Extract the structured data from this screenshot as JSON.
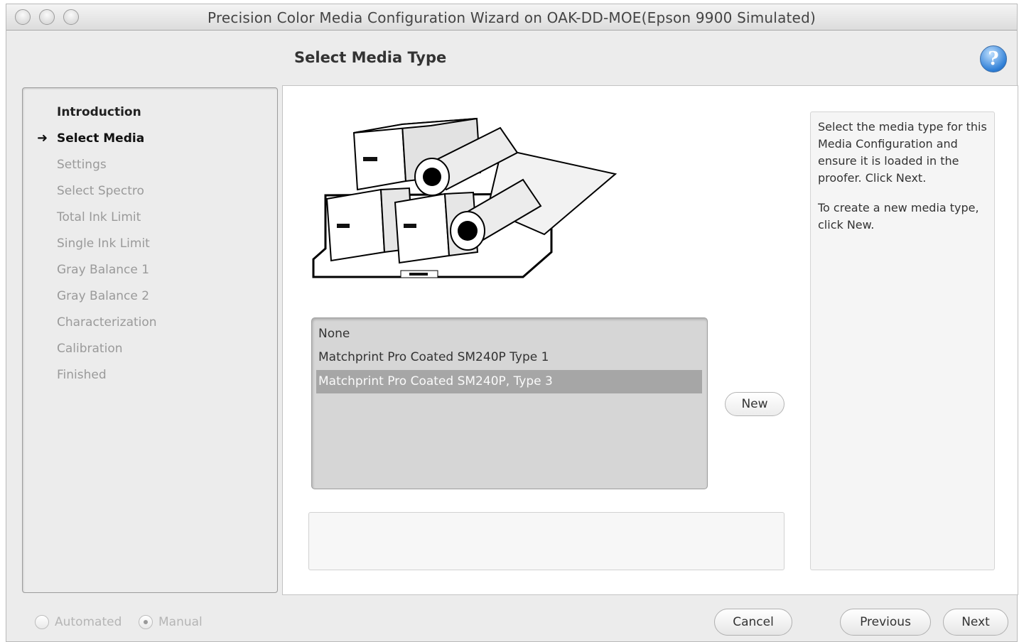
{
  "window": {
    "title": "Precision Color Media Configuration Wizard on OAK-DD-MOE(Epson 9900 Simulated)"
  },
  "header": {
    "title": "Select Media Type",
    "help_icon": "question-mark-icon",
    "help_label": "?"
  },
  "sidebar": {
    "current_marker": "➜",
    "steps": [
      {
        "label": "Introduction",
        "state": "done"
      },
      {
        "label": "Select Media",
        "state": "current"
      },
      {
        "label": "Settings",
        "state": "pending"
      },
      {
        "label": "Select Spectro",
        "state": "pending"
      },
      {
        "label": "Total Ink Limit",
        "state": "pending"
      },
      {
        "label": "Single Ink Limit",
        "state": "pending"
      },
      {
        "label": "Gray Balance 1",
        "state": "pending"
      },
      {
        "label": "Gray Balance 2",
        "state": "pending"
      },
      {
        "label": "Characterization",
        "state": "pending"
      },
      {
        "label": "Calibration",
        "state": "pending"
      },
      {
        "label": "Finished",
        "state": "pending"
      }
    ]
  },
  "media_list": {
    "items": [
      {
        "label": "None",
        "selected": false
      },
      {
        "label": "Matchprint Pro Coated SM240P Type 1",
        "selected": false
      },
      {
        "label": "Matchprint Pro Coated SM240P, Type 3",
        "selected": true
      }
    ]
  },
  "new_button": "New",
  "description_value": "",
  "help_text": {
    "p1": "Select the media type for this Media Configuration and ensure it is loaded in the proofer. Click Next.",
    "p2": "To create a new media type, click New."
  },
  "footer": {
    "mode_options": [
      {
        "label": "Automated",
        "checked": false
      },
      {
        "label": "Manual",
        "checked": true
      }
    ],
    "cancel": "Cancel",
    "previous": "Previous",
    "next": "Next"
  },
  "colors": {
    "selection": "#a6a6a6",
    "help_icon_blue": "#2f7fd6"
  }
}
